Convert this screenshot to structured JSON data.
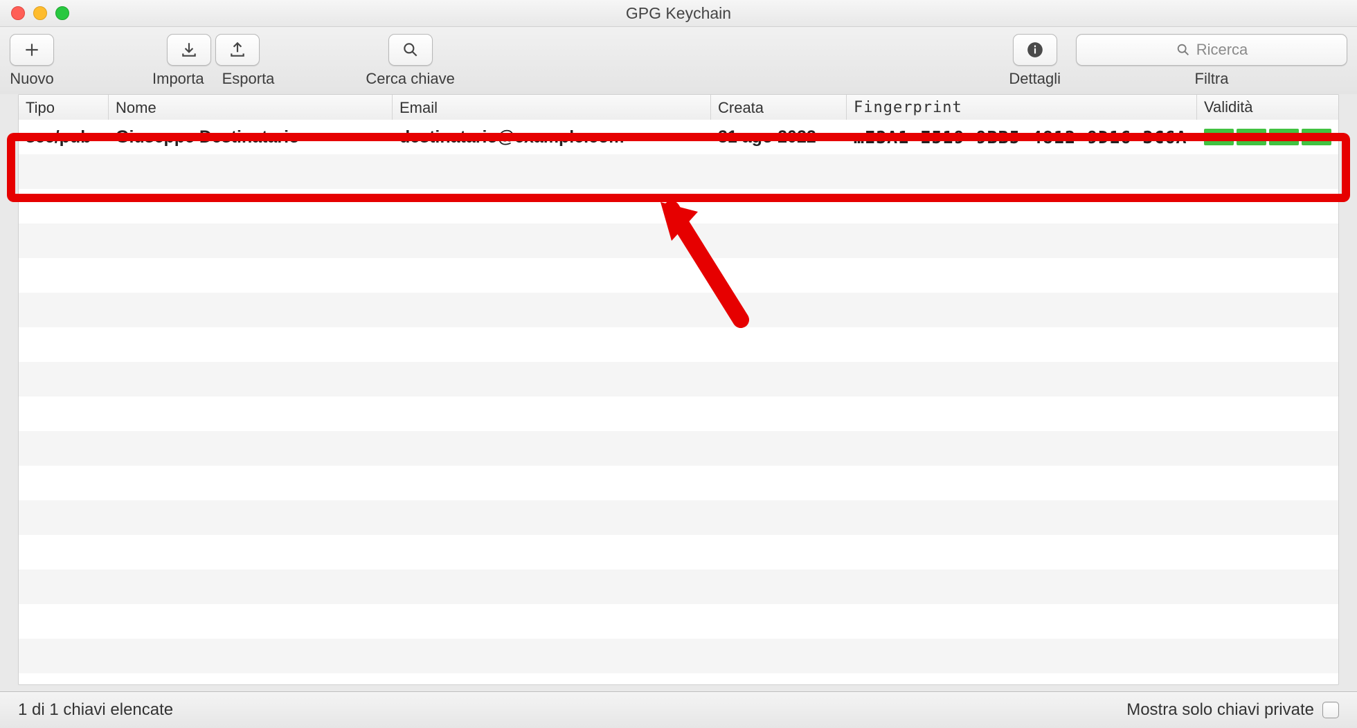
{
  "window": {
    "title": "GPG Keychain"
  },
  "toolbar": {
    "new_label": "Nuovo",
    "import_label": "Importa",
    "export_label": "Esporta",
    "lookup_label": "Cerca chiave",
    "details_label": "Dettagli",
    "filter_label": "Filtra"
  },
  "search": {
    "placeholder": "Ricerca"
  },
  "table": {
    "headers": {
      "type": "Tipo",
      "name": "Nome",
      "email": "Email",
      "created": "Creata",
      "fingerprint": "Fingerprint",
      "validity": "Validità"
    },
    "rows": [
      {
        "type": "sec/pub",
        "name": "Giuseppe Destinatario",
        "email": "destinatario@example.com",
        "date": "31 ago 2022",
        "fingerprint": "…E3A1  E519  9BB5  4812  9D16  3C6A",
        "validity_blocks": 4
      }
    ],
    "blank_rows": 15
  },
  "statusbar": {
    "left": "1 di 1 chiavi elencate",
    "right": "Mostra solo chiavi private"
  },
  "colors": {
    "highlight": "#e60000",
    "valid_green": "#41c241"
  }
}
